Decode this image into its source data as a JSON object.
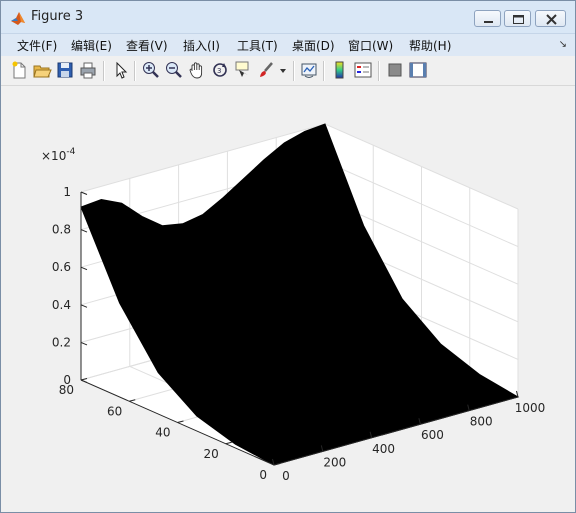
{
  "window": {
    "title": "Figure 3",
    "minimize_icon": "minimize-icon",
    "maximize_icon": "maximize-icon",
    "close_icon": "close-icon"
  },
  "menu": {
    "items": [
      "文件(F)",
      "编辑(E)",
      "查看(V)",
      "插入(I)",
      "工具(T)",
      "桌面(D)",
      "窗口(W)",
      "帮助(H)"
    ],
    "overflow_icon": "dock-arrow-icon"
  },
  "toolbar": {
    "icons": [
      "new-figure-icon",
      "open-file-icon",
      "save-icon",
      "print-icon",
      "edit-plot-arrow-icon",
      "zoom-in-icon",
      "zoom-out-icon",
      "pan-hand-icon",
      "rotate-3d-icon",
      "data-cursor-icon",
      "brush-icon",
      "brush-dropdown-icon",
      "link-plot-icon",
      "colorbar-icon",
      "legend-icon",
      "hide-plot-tools-icon",
      "show-plot-tools-icon"
    ]
  },
  "chart_data": {
    "type": "surface",
    "color": "#000000",
    "exponent_label": "×10^-4",
    "exponent_text": "×10",
    "exponent_power": "-4",
    "x_axis": {
      "range": [
        0,
        1000
      ],
      "ticks": [
        "0",
        "200",
        "400",
        "600",
        "800",
        "1000"
      ]
    },
    "y_axis": {
      "range": [
        0,
        80
      ],
      "ticks": [
        "0",
        "20",
        "40",
        "60",
        "80"
      ]
    },
    "z_axis": {
      "range": [
        0,
        1
      ],
      "ticks": [
        "0",
        "0.2",
        "0.4",
        "0.6",
        "0.8",
        "1"
      ]
    },
    "grid": true,
    "surface_shape": {
      "edge_y80_z": [
        0.92,
        0.93,
        0.88,
        0.78,
        0.7,
        0.68,
        0.7,
        0.76,
        0.83,
        0.9,
        0.96,
        0.99,
        1.0
      ],
      "edge_x1000_y80_to_0_z": [
        1.0,
        0.55,
        0.25,
        0.1,
        0.03,
        0.0
      ],
      "edge_x0_y80_to_0_z": [
        0.92,
        0.5,
        0.22,
        0.08,
        0.02,
        0.0
      ]
    }
  }
}
